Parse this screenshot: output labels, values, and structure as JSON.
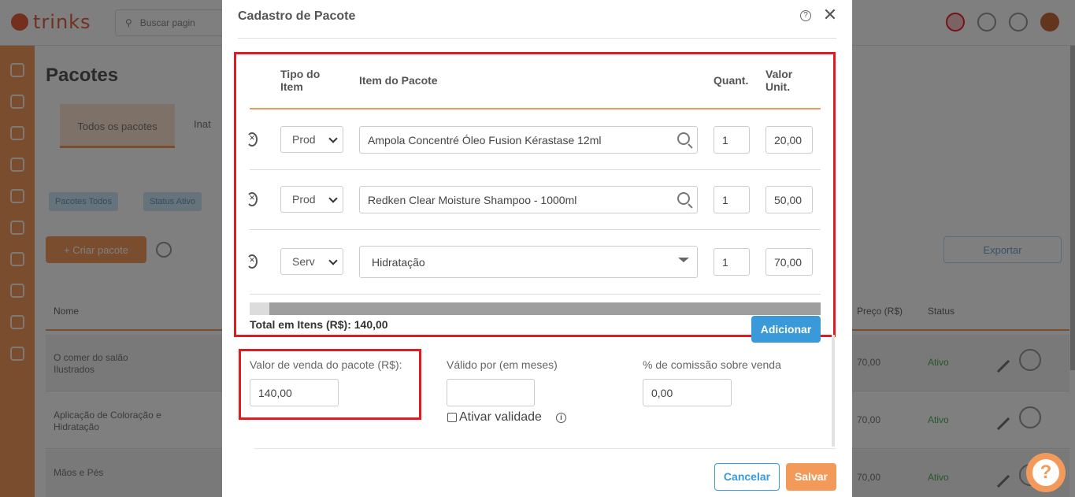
{
  "background": {
    "logo_text": "trinks",
    "search_placeholder": "Buscar pagin",
    "page_title": "Pacotes",
    "tabs": [
      "Todos os pacotes",
      "Inat"
    ],
    "filter_chips": [
      "Pacotes Todos",
      "Status Ativo"
    ],
    "new_button": "+ Criar pacote",
    "export_button": "Exportar",
    "columns": [
      "Nome",
      "Preço (R$)",
      "Status"
    ],
    "rows": [
      {
        "name": "O comer do salão Ilustrados",
        "price": "70,00",
        "status": "Ativo"
      },
      {
        "name": "Aplicação de Coloração e Hidratação",
        "price": "70,00",
        "status": "Ativo"
      },
      {
        "name": "Mãos e Pés",
        "price": "70,00",
        "status": "Ativo"
      }
    ]
  },
  "modal": {
    "title": "Cadastro de Pacote",
    "items_header": {
      "type": "Tipo do Item",
      "item": "Item do Pacote",
      "qty": "Quant.",
      "unit_value": "Valor Unit."
    },
    "items": [
      {
        "type": "Prod",
        "item": "Ampola Concentré Óleo Fusion Kérastase 12ml",
        "qty": "1",
        "unit_value": "20,00",
        "control": "search"
      },
      {
        "type": "Prod",
        "item": "Redken Clear Moisture Shampoo - 1000ml",
        "qty": "1",
        "unit_value": "50,00",
        "control": "search"
      },
      {
        "type": "Serv",
        "item": "Hidratação",
        "qty": "1",
        "unit_value": "70,00",
        "control": "dropdown"
      }
    ],
    "total_label": "Total em Itens (R$): 140,00",
    "add_button": "Adicionar",
    "sale_value_label": "Valor de venda do pacote (R$):",
    "sale_value": "140,00",
    "valid_months_label": "Válido por (em meses)",
    "valid_months_value": "",
    "commission_label": "% de comissão sobre venda",
    "commission_value": "0,00",
    "activate_validity_label": "Ativar validade",
    "activate_validity_checked": false,
    "cancel_button": "Cancelar",
    "save_button": "Salvar"
  },
  "colors": {
    "accent_orange": "#f39a5a",
    "primary_blue": "#3a9ad9",
    "highlight_red": "#e21b23"
  }
}
